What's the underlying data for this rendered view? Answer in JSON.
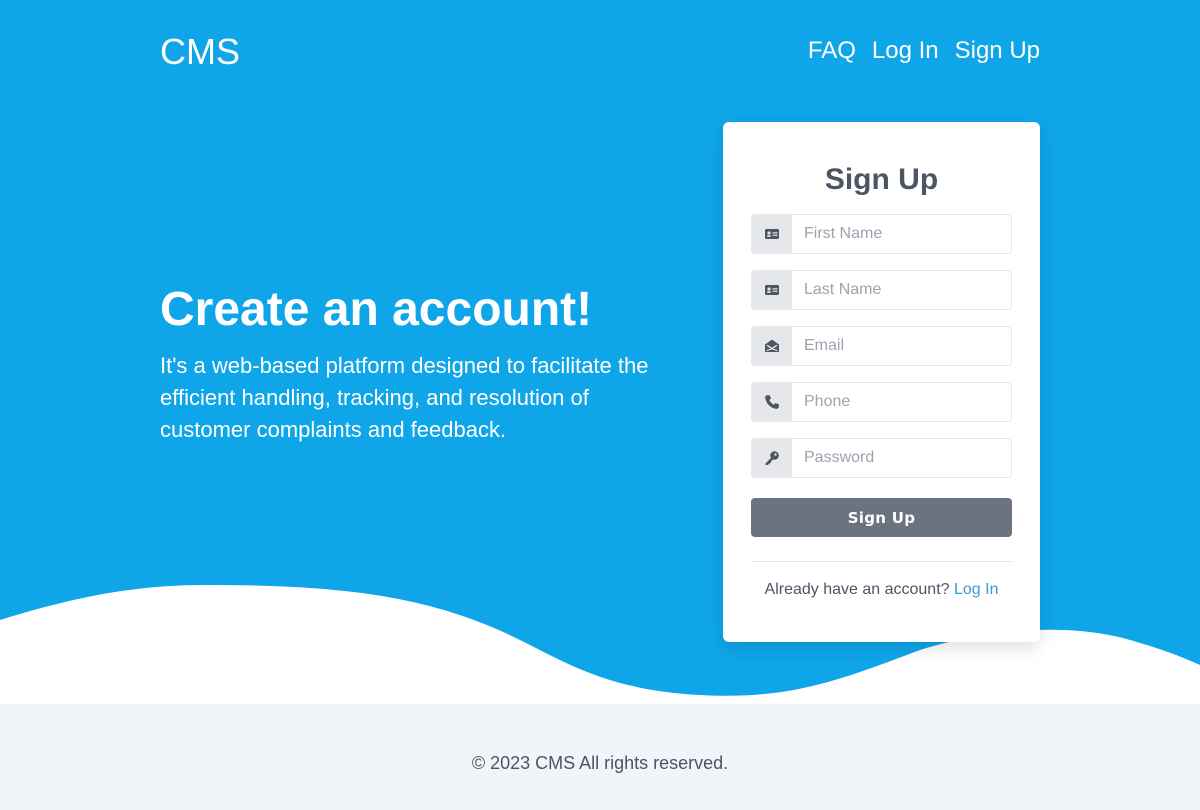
{
  "header": {
    "brand": "CMS",
    "nav": [
      "FAQ",
      "Log In",
      "Sign Up"
    ]
  },
  "hero": {
    "title": "Create an account!",
    "description": "It's a web-based platform designed to facilitate the efficient handling, tracking, and resolution of customer complaints and feedback."
  },
  "form": {
    "title": "Sign Up",
    "fields": [
      {
        "placeholder": "First Name",
        "value": "",
        "icon": "id-card-icon"
      },
      {
        "placeholder": "Last Name",
        "value": "",
        "icon": "id-card-icon"
      },
      {
        "placeholder": "Email",
        "value": "",
        "icon": "envelope-open-icon"
      },
      {
        "placeholder": "Phone",
        "value": "",
        "icon": "phone-icon"
      },
      {
        "placeholder": "Password",
        "value": "",
        "icon": "key-icon"
      }
    ],
    "submit_label": "Sign Up",
    "login_prompt": "Already have an account?",
    "login_link": "Log In"
  },
  "footer": {
    "copyright": "© 2023 CMS All rights reserved."
  },
  "colors": {
    "hero_background": "#0ea5e9",
    "submit_button": "#6b7280",
    "link": "#3b9ad6",
    "footer_background": "#f1f5f9"
  }
}
